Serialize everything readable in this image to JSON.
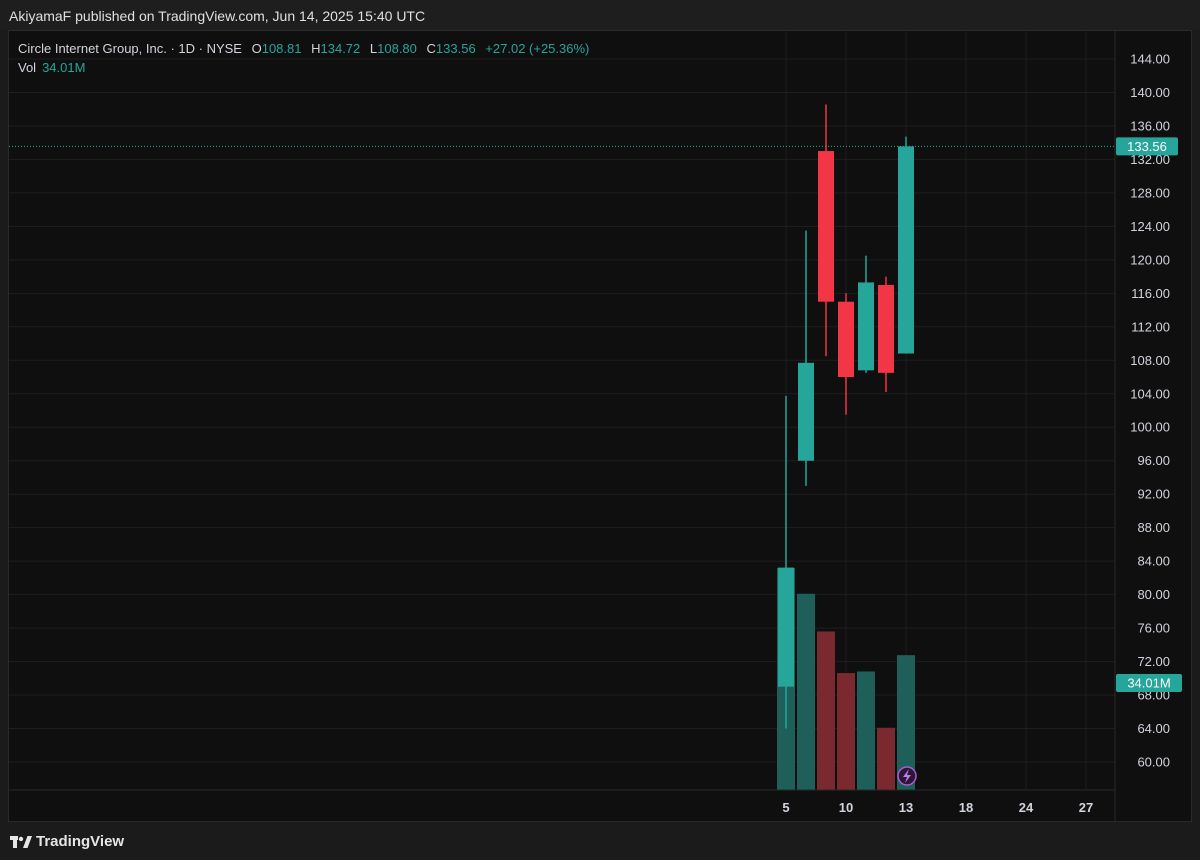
{
  "header": {
    "publish_line": "AkiyamaF published on TradingView.com, Jun 14, 2025 15:40 UTC"
  },
  "legend": {
    "symbol": "Circle Internet Group, Inc. · 1D · NYSE",
    "o_label": "O",
    "o_value": "108.81",
    "h_label": "H",
    "h_value": "134.72",
    "l_label": "L",
    "l_value": "108.80",
    "c_label": "C",
    "c_value": "133.56",
    "change": "+27.02 (+25.36%)",
    "vol_label": "Vol",
    "vol_value": "34.01M"
  },
  "price_axis": {
    "ticks": [
      "144.00",
      "140.00",
      "136.00",
      "132.00",
      "128.00",
      "124.00",
      "120.00",
      "116.00",
      "112.00",
      "108.00",
      "104.00",
      "100.00",
      "96.00",
      "92.00",
      "88.00",
      "84.00",
      "80.00",
      "76.00",
      "72.00",
      "68.00",
      "64.00",
      "60.00"
    ],
    "last_price_label": "133.56",
    "last_volume_label": "34.01M"
  },
  "time_axis": {
    "ticks": [
      "5",
      "10",
      "13",
      "18",
      "24",
      "27"
    ]
  },
  "footer": {
    "brand": "TradingView"
  },
  "colors": {
    "up": "#26a69a",
    "down": "#f23645",
    "vol_up": "#1f5f59",
    "vol_down": "#7a2a2e",
    "background": "#0f0f0f",
    "grid": "#1e1e1e",
    "text": "#d1d4dc"
  },
  "chart_data": {
    "type": "candlestick",
    "title": "Circle Internet Group, Inc. · 1D · NYSE",
    "ylim": [
      57,
      147
    ],
    "last_price": 133.56,
    "candles": [
      {
        "date": "Jun 5",
        "open": 69.0,
        "high": 103.75,
        "low": 64.0,
        "close": 83.23
      },
      {
        "date": "Jun 6",
        "open": 96.0,
        "high": 123.5,
        "low": 93.0,
        "close": 107.7
      },
      {
        "date": "Jun 9",
        "open": 133.0,
        "high": 138.57,
        "low": 108.5,
        "close": 115.0
      },
      {
        "date": "Jun 10",
        "open": 115.0,
        "high": 116.0,
        "low": 101.5,
        "close": 106.0
      },
      {
        "date": "Jun 11",
        "open": 106.8,
        "high": 120.5,
        "low": 106.5,
        "close": 117.3
      },
      {
        "date": "Jun 12",
        "open": 117.0,
        "high": 118.0,
        "low": 104.2,
        "close": 106.5
      },
      {
        "date": "Jun 13",
        "open": 108.81,
        "high": 134.72,
        "low": 108.8,
        "close": 133.56
      }
    ],
    "volume": {
      "values_m": [
        56,
        49.5,
        40.0,
        29.5,
        29.9,
        15.7,
        34.01
      ],
      "directions": [
        "up",
        "up",
        "down",
        "down",
        "up",
        "down",
        "up"
      ]
    }
  }
}
